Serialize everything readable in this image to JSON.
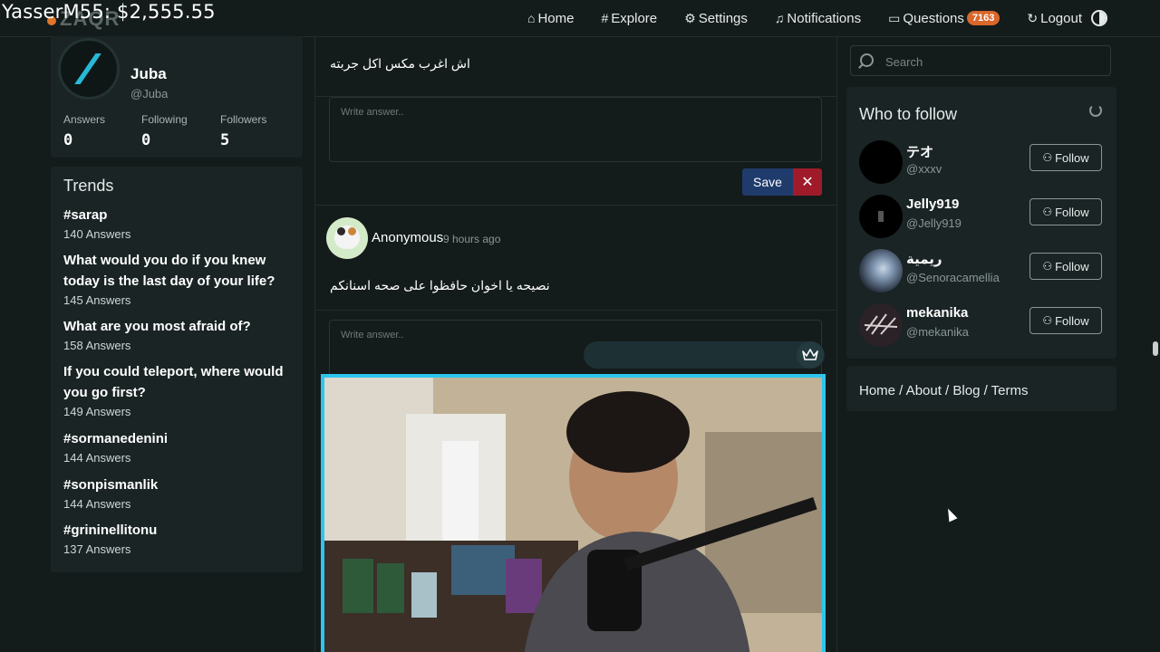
{
  "overlay": {
    "text": "YasserM55: $2,555.55"
  },
  "logo": {
    "text": "ZAQR"
  },
  "nav": {
    "home": "Home",
    "explore": "Explore",
    "settings": "Settings",
    "notifications": "Notifications",
    "questions": "Questions",
    "questions_count": "7163",
    "logout": "Logout"
  },
  "profile": {
    "name": "Juba",
    "handle": "@Juba",
    "stats": [
      {
        "label": "Answers",
        "value": "0"
      },
      {
        "label": "Following",
        "value": "0"
      },
      {
        "label": "Followers",
        "value": "5"
      }
    ]
  },
  "trends": {
    "title": "Trends",
    "items": [
      {
        "title": "#sarap",
        "count": "140 Answers"
      },
      {
        "title": "What would you do if you knew today is the last day of your life?",
        "count": "145 Answers"
      },
      {
        "title": "What are you most afraid of?",
        "count": "158 Answers"
      },
      {
        "title": "If you could teleport, where would you go first?",
        "count": "149 Answers"
      },
      {
        "title": "#sormanedenini",
        "count": "144 Answers"
      },
      {
        "title": "#sonpismanlik",
        "count": "144 Answers"
      },
      {
        "title": "#grininellitonu",
        "count": "137 Answers"
      }
    ]
  },
  "feed": {
    "question1": "اش اغرب مكس اكل جربته",
    "answer_placeholder": "Write answer..",
    "save": "Save",
    "cancel": "✕",
    "post": {
      "user": "Anonymous",
      "time": "9 hours ago",
      "text": "نصيحه يا اخوان حافظوا على صحه اسنانكم"
    }
  },
  "search": {
    "placeholder": "Search"
  },
  "who_to_follow": {
    "title": "Who to follow",
    "follow_label": "Follow",
    "users": [
      {
        "name": "テオ",
        "handle": "@xxxv"
      },
      {
        "name": "Jelly919",
        "handle": "@Jelly919"
      },
      {
        "name": "ريمية",
        "handle": "@Senoracamellia"
      },
      {
        "name": "mekanika",
        "handle": "@mekanika"
      }
    ]
  },
  "footer": {
    "links": "Home / About / Blog / Terms"
  }
}
